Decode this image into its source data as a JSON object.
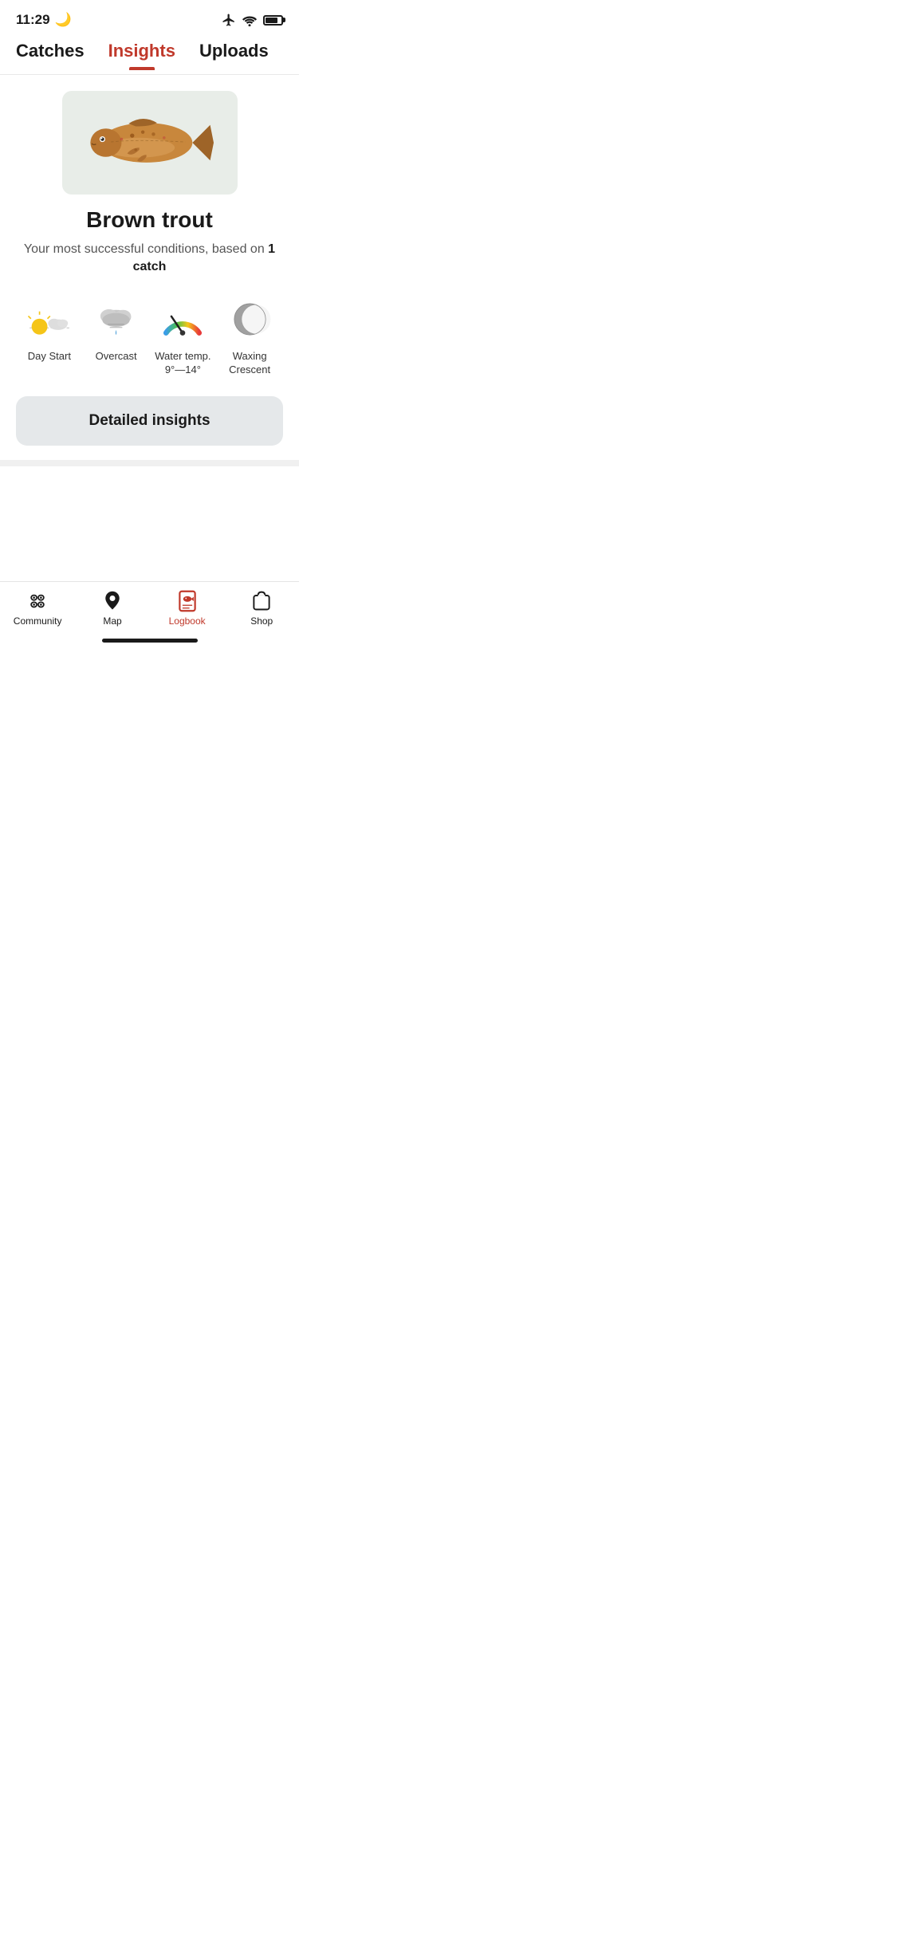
{
  "statusBar": {
    "time": "11:29",
    "moonIcon": "🌙"
  },
  "topTabs": [
    {
      "id": "catches",
      "label": "Catches",
      "active": false
    },
    {
      "id": "insights",
      "label": "Insights",
      "active": true
    },
    {
      "id": "uploads",
      "label": "Uploads",
      "active": false
    }
  ],
  "fishCard": {
    "fishName": "Brown trout",
    "description": "Your most successful conditions, based on",
    "catchCount": "1 catch",
    "conditions": [
      {
        "id": "day-start",
        "label": "Day Start"
      },
      {
        "id": "overcast",
        "label": "Overcast"
      },
      {
        "id": "water-temp",
        "label": "Water temp.\n9°—14°"
      },
      {
        "id": "waxing-crescent",
        "label": "Waxing Crescent"
      }
    ]
  },
  "detailedInsights": {
    "buttonLabel": "Detailed insights"
  },
  "bottomNav": [
    {
      "id": "community",
      "label": "Community",
      "active": false
    },
    {
      "id": "map",
      "label": "Map",
      "active": false
    },
    {
      "id": "logbook",
      "label": "Logbook",
      "active": true
    },
    {
      "id": "shop",
      "label": "Shop",
      "active": false
    }
  ]
}
